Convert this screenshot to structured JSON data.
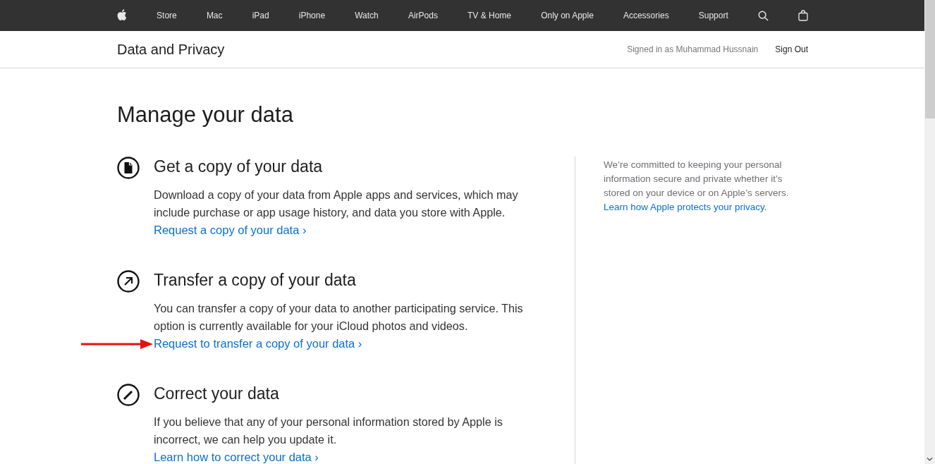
{
  "nav": {
    "items": [
      "Store",
      "Mac",
      "iPad",
      "iPhone",
      "Watch",
      "AirPods",
      "TV & Home",
      "Only on Apple",
      "Accessories",
      "Support"
    ]
  },
  "subheader": {
    "title": "Data and Privacy",
    "signed_in": "Signed in as Muhammad Hussnain",
    "sign_out": "Sign Out"
  },
  "heading": "Manage your data",
  "sections": [
    {
      "kind": "document",
      "title": "Get a copy of your data",
      "body": "Download a copy of your data from Apple apps and services, which may include purchase or app usage history, and data you store with Apple.",
      "link": "Request a copy of your data ›",
      "annotated": false
    },
    {
      "kind": "transfer",
      "title": "Transfer a copy of your data",
      "body": "You can transfer a copy of your data to another participating service. This option is currently available for your iCloud photos and videos.",
      "link": "Request to transfer a copy of your data ›",
      "annotated": true
    },
    {
      "kind": "pencil",
      "title": "Correct your data",
      "body": "If you believe that any of your personal information stored by Apple is incorrect, we can help you update it.",
      "link": "Learn how to correct your data ›",
      "annotated": false
    }
  ],
  "aside": {
    "text": "We’re committed to keeping your personal information secure and private whether it’s stored on your device or on Apple’s servers.",
    "link": "Learn how Apple protects your privacy."
  }
}
